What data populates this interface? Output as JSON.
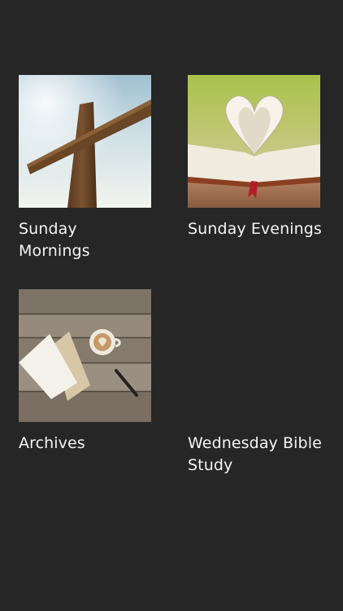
{
  "series": [
    {
      "label": "Sunday Mornings",
      "thumbnail": "cross-image"
    },
    {
      "label": "Sunday Evenings",
      "thumbnail": "bible-heart-image"
    },
    {
      "label": "Archives",
      "thumbnail": "desk-notebook-coffee-image"
    },
    {
      "label": "Wednesday Bible Study",
      "thumbnail": "none"
    }
  ],
  "colors": {
    "background": "#262626",
    "text": "#f4f4f4"
  }
}
